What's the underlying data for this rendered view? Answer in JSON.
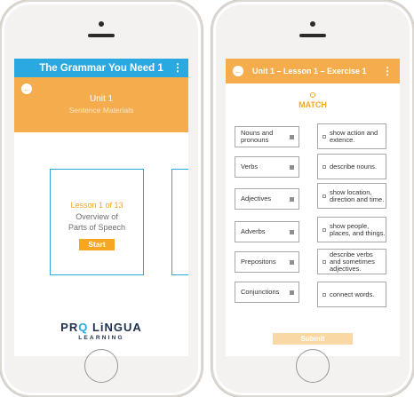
{
  "left_screen": {
    "app_title": "The Grammar You Need 1",
    "menu_glyph": "⋮",
    "back_glyph": "←",
    "unit_title": "Unit 1",
    "unit_subtitle": "Sentence Materials",
    "lesson_label": "Lesson 1 of 13",
    "lesson_title_line1": "Overview of",
    "lesson_title_line2": "Parts of Speech",
    "start_label": "Start",
    "logo_top_pre": "PR",
    "logo_top_q": "Q",
    "logo_top_post": " LiNGUA",
    "logo_bottom": "LEARNING"
  },
  "right_screen": {
    "header_title": "Unit 1 – Lesson 1 – Exercise 1",
    "menu_glyph": "⋮",
    "back_glyph": "←",
    "match_title": "MATCH",
    "left_items": [
      {
        "label": "Nouns and pronouns"
      },
      {
        "label": "Verbs"
      },
      {
        "label": "Adjectives"
      },
      {
        "label": "Adverbs"
      },
      {
        "label": "Prepositons"
      },
      {
        "label": "Conjunctions"
      }
    ],
    "right_items": [
      {
        "label": "show action and extence."
      },
      {
        "label": "describe nouns."
      },
      {
        "label": "show location, direction and time."
      },
      {
        "label": "show people, places, and things."
      },
      {
        "label": "describe verbs and sometimes adjectives."
      },
      {
        "label": "connect words."
      }
    ],
    "submit_label": "Submit"
  },
  "colors": {
    "accent_orange": "#f5ac4c",
    "accent_blue": "#2aa8e0",
    "brand_navy": "#1e3050"
  }
}
